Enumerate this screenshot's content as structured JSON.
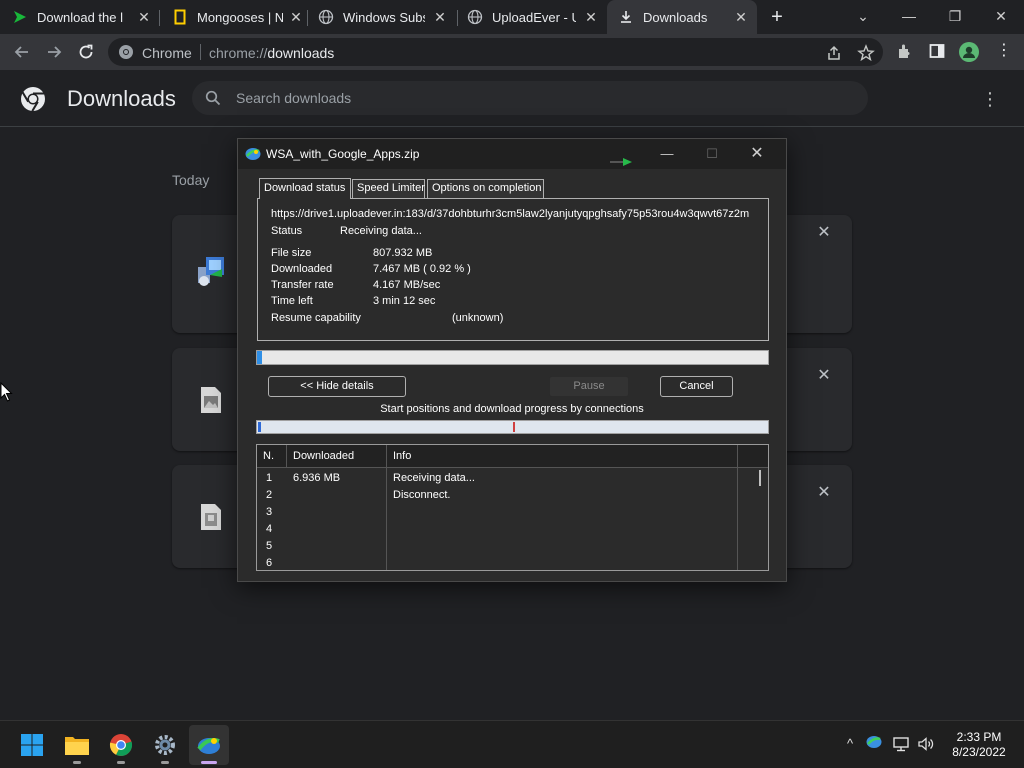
{
  "tabs": [
    {
      "title": "Download the latest",
      "icon": "idm-arrow-icon",
      "active": false
    },
    {
      "title": "Mongooses | National Geographic",
      "icon": "natgeo-icon",
      "active": false
    },
    {
      "title": "Windows Subsystem",
      "icon": "globe-icon",
      "active": false
    },
    {
      "title": "UploadEver - Upload",
      "icon": "globe-icon",
      "active": false
    },
    {
      "title": "Downloads",
      "icon": "download-icon",
      "active": true
    }
  ],
  "omnibox": {
    "site_label": "Chrome",
    "url_scheme": "chrome://",
    "url_path": "downloads"
  },
  "downloads_page": {
    "title": "Downloads",
    "search_placeholder": "Search downloads",
    "section_today": "Today"
  },
  "colors": {
    "accent": "#5bb974",
    "dialog_bg": "#2b2b2b",
    "chrome_bg": "#202124"
  },
  "idm": {
    "window_title": "WSA_with_Google_Apps.zip",
    "tabs": [
      "Download status",
      "Speed Limiter",
      "Options on completion"
    ],
    "url": "https://drive1.uploadever.in:183/d/37dohbturhr3cm5law2lyanjutyqpghsafy75p53rou4w3qwvt67z2m",
    "status_label": "Status",
    "status_value": "Receiving data...",
    "fields": [
      {
        "label": "File size",
        "value": "807.932  MB"
      },
      {
        "label": "Downloaded",
        "value": "7.467  MB  ( 0.92 % )"
      },
      {
        "label": "Transfer rate",
        "value": "4.167  MB/sec"
      },
      {
        "label": "Time left",
        "value": "3 min 12 sec"
      }
    ],
    "resume_label": "Resume capability",
    "resume_value": "(unknown)",
    "progress_fraction": 0.0092,
    "hide_details_label": "<< Hide details",
    "pause_label": "Pause",
    "cancel_label": "Cancel",
    "connections_caption": "Start positions and download progress by connections",
    "table_headers": [
      "N.",
      "Downloaded",
      "Info"
    ],
    "connections": [
      {
        "n": "1",
        "downloaded": "6.936  MB",
        "info": "Receiving data..."
      },
      {
        "n": "2",
        "downloaded": "",
        "info": "Disconnect."
      },
      {
        "n": "3",
        "downloaded": "",
        "info": ""
      },
      {
        "n": "4",
        "downloaded": "",
        "info": ""
      },
      {
        "n": "5",
        "downloaded": "",
        "info": ""
      },
      {
        "n": "6",
        "downloaded": "",
        "info": ""
      }
    ]
  },
  "clock": {
    "time": "2:33 PM",
    "date": "8/23/2022"
  }
}
